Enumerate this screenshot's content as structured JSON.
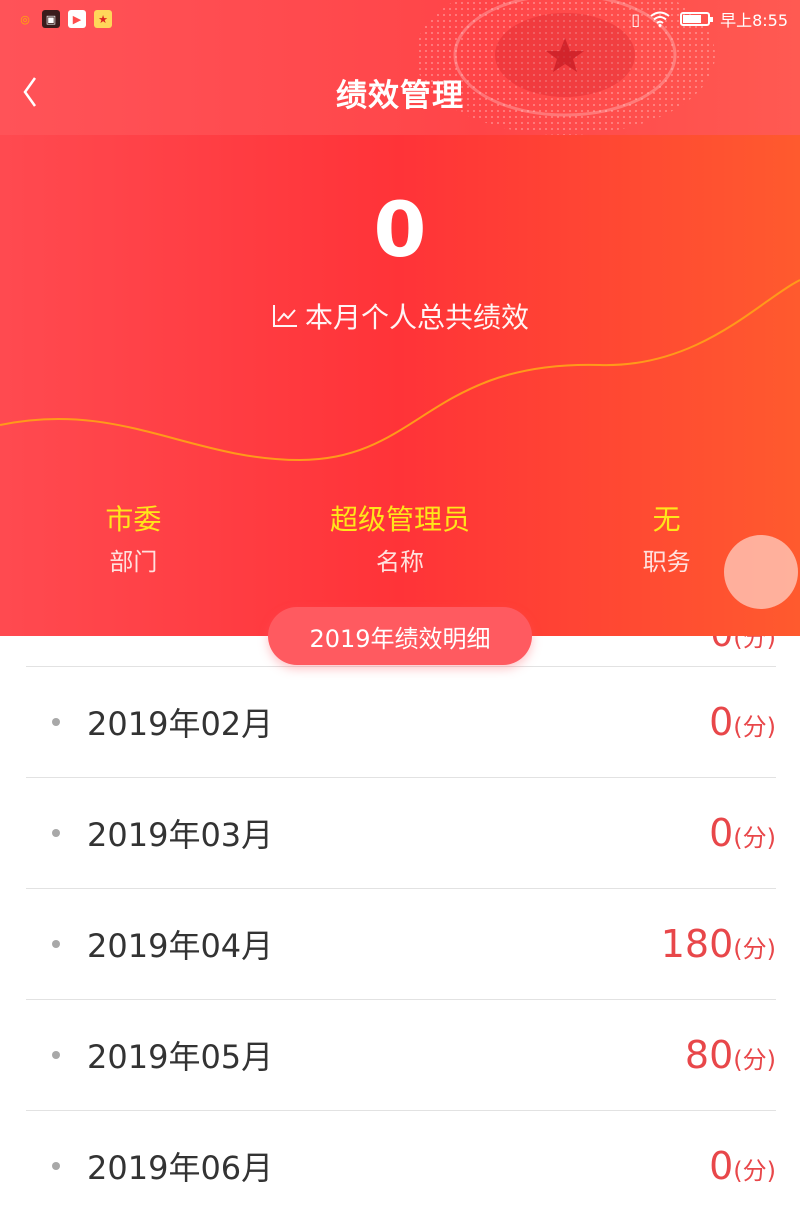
{
  "status_bar": {
    "time": "早上8:55",
    "app_icons": [
      "weibo-icon",
      "shopping-icon",
      "video-icon",
      "party-badge-icon"
    ],
    "system_icons": [
      "vibrate-icon",
      "wifi-icon",
      "battery-icon"
    ]
  },
  "nav": {
    "back_icon": "chevron-left-icon",
    "title": "绩效管理"
  },
  "hero": {
    "value": "0",
    "label": "本月个人总共绩效",
    "label_icon": "trend-chart-icon"
  },
  "info": [
    {
      "value": "市委",
      "label": "部门"
    },
    {
      "value": "超级管理员",
      "label": "名称"
    },
    {
      "value": "无",
      "label": "职务"
    }
  ],
  "detail_button": "2019年绩效明细",
  "list": {
    "partial_score": "0",
    "unit": "(分)",
    "rows": [
      {
        "month": "2019年02月",
        "score": "0"
      },
      {
        "month": "2019年03月",
        "score": "0"
      },
      {
        "month": "2019年04月",
        "score": "180"
      },
      {
        "month": "2019年05月",
        "score": "80"
      },
      {
        "month": "2019年06月",
        "score": "0"
      }
    ]
  },
  "colors": {
    "primary_red": "#ff3a3f",
    "accent_yellow": "#ffe61a",
    "score_red": "#e8474a",
    "pill": "#ff5a60"
  }
}
